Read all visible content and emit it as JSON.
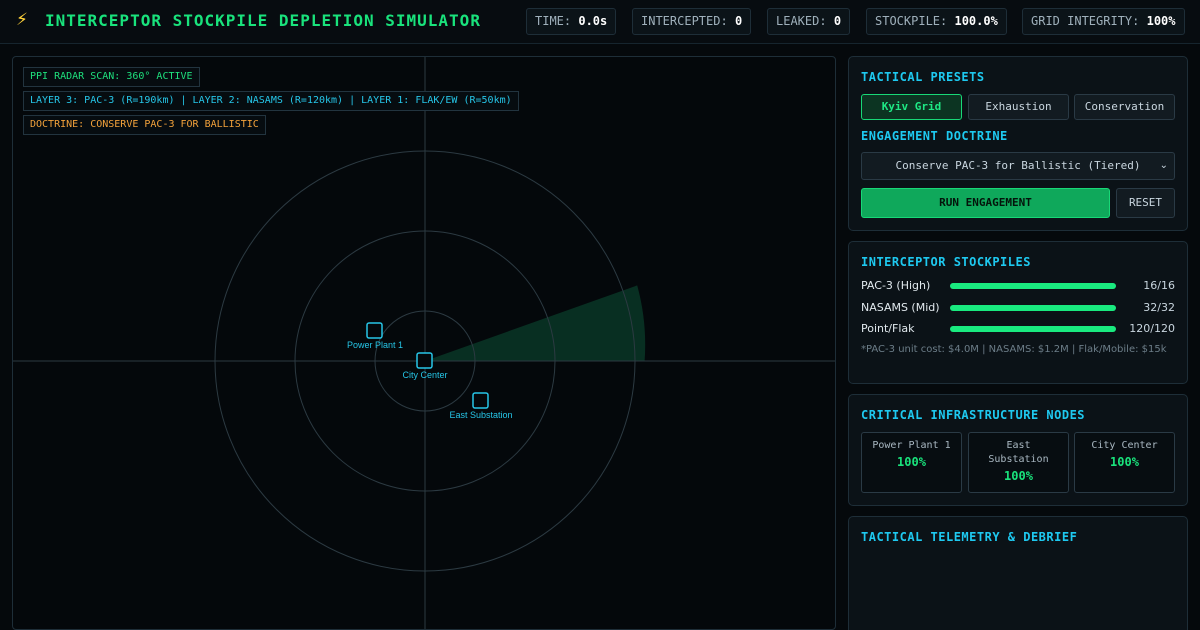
{
  "header": {
    "logo_icon": "⚡",
    "title": "INTERCEPTOR STOCKPILE DEPLETION SIMULATOR",
    "stats": [
      {
        "label": "TIME:",
        "value": "0.0s"
      },
      {
        "label": "INTERCEPTED:",
        "value": "0"
      },
      {
        "label": "LEAKED:",
        "value": "0"
      },
      {
        "label": "STOCKPILE:",
        "value": "100.0%"
      },
      {
        "label": "GRID INTEGRITY:",
        "value": "100%"
      }
    ]
  },
  "radar": {
    "tags": {
      "scan": "PPI RADAR SCAN: 360° ACTIVE",
      "layers": "LAYER 3: PAC-3 (R=190km) | LAYER 2: NASAMS (R=120km) | LAYER 1: FLAK/EW (R=50km)",
      "doctrine": "DOCTRINE: CONSERVE PAC-3 FOR BALLISTIC"
    },
    "nodes": [
      {
        "label": "Power Plant 1"
      },
      {
        "label": "City Center"
      },
      {
        "label": "East Substation"
      }
    ],
    "colors": {
      "node": "#26c6e8",
      "ring": "#2c3a42",
      "sweep": "#0f6b45"
    }
  },
  "presets": {
    "title": "TACTICAL PRESETS",
    "buttons": [
      "Kyiv Grid",
      "Exhaustion",
      "Conservation"
    ],
    "active_index": 0
  },
  "doctrine": {
    "title": "ENGAGEMENT DOCTRINE",
    "selected": "Conserve PAC-3 for Ballistic (Tiered)",
    "run_label": "RUN ENGAGEMENT",
    "reset_label": "RESET"
  },
  "stockpiles": {
    "title": "INTERCEPTOR STOCKPILES",
    "items": [
      {
        "name": "PAC-3 (High)",
        "count": "16/16",
        "fraction": 1.0
      },
      {
        "name": "NASAMS (Mid)",
        "count": "32/32",
        "fraction": 1.0
      },
      {
        "name": "Point/Flak",
        "count": "120/120",
        "fraction": 1.0
      }
    ],
    "note": "*PAC-3 unit cost: $4.0M | NASAMS: $1.2M | Flak/Mobile: $15k"
  },
  "infrastructure": {
    "title": "CRITICAL INFRASTRUCTURE NODES",
    "nodes": [
      {
        "name": "Power Plant 1",
        "value": "100%"
      },
      {
        "name": "East Substation",
        "value": "100%"
      },
      {
        "name": "City Center",
        "value": "100%"
      }
    ]
  },
  "telemetry": {
    "title": "TACTICAL TELEMETRY & DEBRIEF"
  }
}
